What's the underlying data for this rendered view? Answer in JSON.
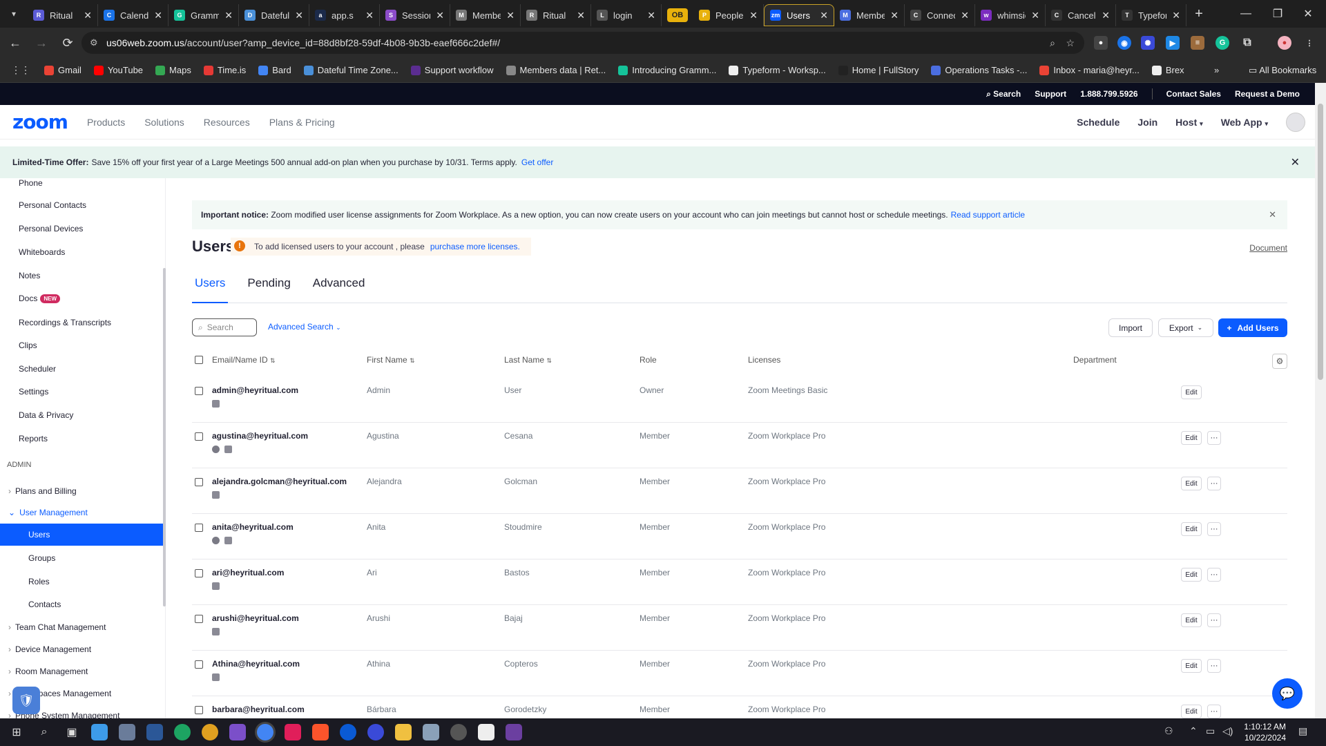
{
  "browser": {
    "tabs": [
      {
        "title": "Ritual",
        "color": "#5b5bd6",
        "icon": "R"
      },
      {
        "title": "Calendar",
        "color": "#1a73e8",
        "icon": "C"
      },
      {
        "title": "Grammarly",
        "color": "#15c39a",
        "icon": "G"
      },
      {
        "title": "Dateful",
        "color": "#4a90d9",
        "icon": "D"
      },
      {
        "title": "app.s",
        "color": "#1b2a4a",
        "icon": "a"
      },
      {
        "title": "Sessions",
        "color": "#8c4cc9",
        "icon": "S"
      },
      {
        "title": "Members",
        "color": "#777",
        "icon": "M"
      },
      {
        "title": "Ritual",
        "color": "#777",
        "icon": "R"
      },
      {
        "title": "login",
        "color": "#555",
        "icon": "L"
      },
      {
        "title": "People",
        "color": "#e8b10c",
        "icon": "P"
      },
      {
        "title": "Users",
        "color": "#0b5cff",
        "icon": "zm",
        "active": true
      },
      {
        "title": "Members",
        "color": "#4b6ee0",
        "icon": "M"
      },
      {
        "title": "Connect",
        "color": "#444",
        "icon": "C"
      },
      {
        "title": "whimsical",
        "color": "#7b2cbf",
        "icon": "w"
      },
      {
        "title": "Cancel",
        "color": "#333",
        "icon": "C"
      },
      {
        "title": "Typeform",
        "color": "#333",
        "icon": "T"
      }
    ],
    "ob_label": "OB",
    "url_host": "us06web.zoom.us",
    "url_path": "/account/user?amp_device_id=88d8bf28-59df-4b08-9b3b-eaef666c2def#/",
    "bookmarks": [
      {
        "label": "Gmail",
        "color": "#ea4335"
      },
      {
        "label": "YouTube",
        "color": "#ff0000"
      },
      {
        "label": "Maps",
        "color": "#34a853"
      },
      {
        "label": "Time.is",
        "color": "#e53935"
      },
      {
        "label": "Bard",
        "color": "#4285f4"
      },
      {
        "label": "Dateful Time Zone...",
        "color": "#4a90d9"
      },
      {
        "label": "Support workflow",
        "color": "#5b2d91"
      },
      {
        "label": "Members data | Ret...",
        "color": "#888"
      },
      {
        "label": "Introducing Gramm...",
        "color": "#15c39a"
      },
      {
        "label": "Typeform - Worksp...",
        "color": "#eee"
      },
      {
        "label": "Home | FullStory",
        "color": "#222"
      },
      {
        "label": "Operations Tasks -...",
        "color": "#4b6ee0"
      },
      {
        "label": "Inbox - maria@heyr...",
        "color": "#ea4335"
      },
      {
        "label": "Brex",
        "color": "#eee"
      }
    ],
    "all_bookmarks": "All Bookmarks"
  },
  "zoom": {
    "top": {
      "search": "Search",
      "support": "Support",
      "phone": "1.888.799.5926",
      "contact_sales": "Contact Sales",
      "request_demo": "Request a Demo"
    },
    "logo": "zoom",
    "nav": [
      "Products",
      "Solutions",
      "Resources",
      "Plans & Pricing"
    ],
    "right_nav": {
      "schedule": "Schedule",
      "join": "Join",
      "host": "Host",
      "web_app": "Web App"
    },
    "promo": {
      "bold": "Limited-Time Offer:",
      "text": "Save 15% off your first year of a Large Meetings 500 annual add-on plan when you purchase by 10/31. Terms apply.",
      "link": "Get offer"
    }
  },
  "sidebar": {
    "items_top": [
      "Phone",
      "Personal Contacts",
      "Personal Devices",
      "Whiteboards",
      "Notes",
      "Docs",
      "Recordings & Transcripts",
      "Clips",
      "Scheduler",
      "Settings",
      "Data & Privacy",
      "Reports"
    ],
    "new_badge": "NEW",
    "admin_label": "ADMIN",
    "plans_billing": "Plans and Billing",
    "user_management": "User Management",
    "sub_items": [
      "Users",
      "Groups",
      "Roles",
      "Contacts"
    ],
    "more_parents": [
      "Team Chat Management",
      "Device Management",
      "Room Management",
      "Workspaces Management",
      "Phone System Management"
    ]
  },
  "main": {
    "notice": {
      "bold": "Important notice:",
      "text": "Zoom modified user license assignments for Zoom Workplace. As a new option, you can now create users on your account who can join meetings but cannot host or schedule meetings.",
      "link": "Read support article"
    },
    "title": "Users",
    "license_warn": {
      "text": "To add licensed users to your account ,  please",
      "link": "purchase more licenses."
    },
    "document": "Document",
    "tabs": [
      "Users",
      "Pending",
      "Advanced"
    ],
    "search_placeholder": "Search",
    "advanced_search": "Advanced Search",
    "import": "Import",
    "export": "Export",
    "add_users": "Add Users",
    "columns": [
      "Email/Name ID",
      "First Name",
      "Last Name",
      "Role",
      "Licenses",
      "Department"
    ],
    "edit_label": "Edit",
    "rows": [
      {
        "email": "admin@heyritual.com",
        "first": "Admin",
        "last": "User",
        "role": "Owner",
        "license": "Zoom Meetings Basic"
      },
      {
        "email": "agustina@heyritual.com",
        "first": "Agustina",
        "last": "Cesana",
        "role": "Member",
        "license": "Zoom Workplace Pro"
      },
      {
        "email": "alejandra.golcman@heyritual.com",
        "first": "Alejandra",
        "last": "Golcman",
        "role": "Member",
        "license": "Zoom Workplace Pro"
      },
      {
        "email": "anita@heyritual.com",
        "first": "Anita",
        "last": "Stoudmire",
        "role": "Member",
        "license": "Zoom Workplace Pro"
      },
      {
        "email": "ari@heyritual.com",
        "first": "Ari",
        "last": "Bastos",
        "role": "Member",
        "license": "Zoom Workplace Pro"
      },
      {
        "email": "arushi@heyritual.com",
        "first": "Arushi",
        "last": "Bajaj",
        "role": "Member",
        "license": "Zoom Workplace Pro"
      },
      {
        "email": "Athina@heyritual.com",
        "first": "Athina",
        "last": "Copteros",
        "role": "Member",
        "license": "Zoom Workplace Pro"
      },
      {
        "email": "barbara@heyritual.com",
        "first": "Bárbara",
        "last": "Gorodetzky",
        "role": "Member",
        "license": "Zoom Workplace Pro"
      }
    ]
  },
  "taskbar": {
    "time": "1:10:12 AM",
    "date": "10/22/2024"
  }
}
